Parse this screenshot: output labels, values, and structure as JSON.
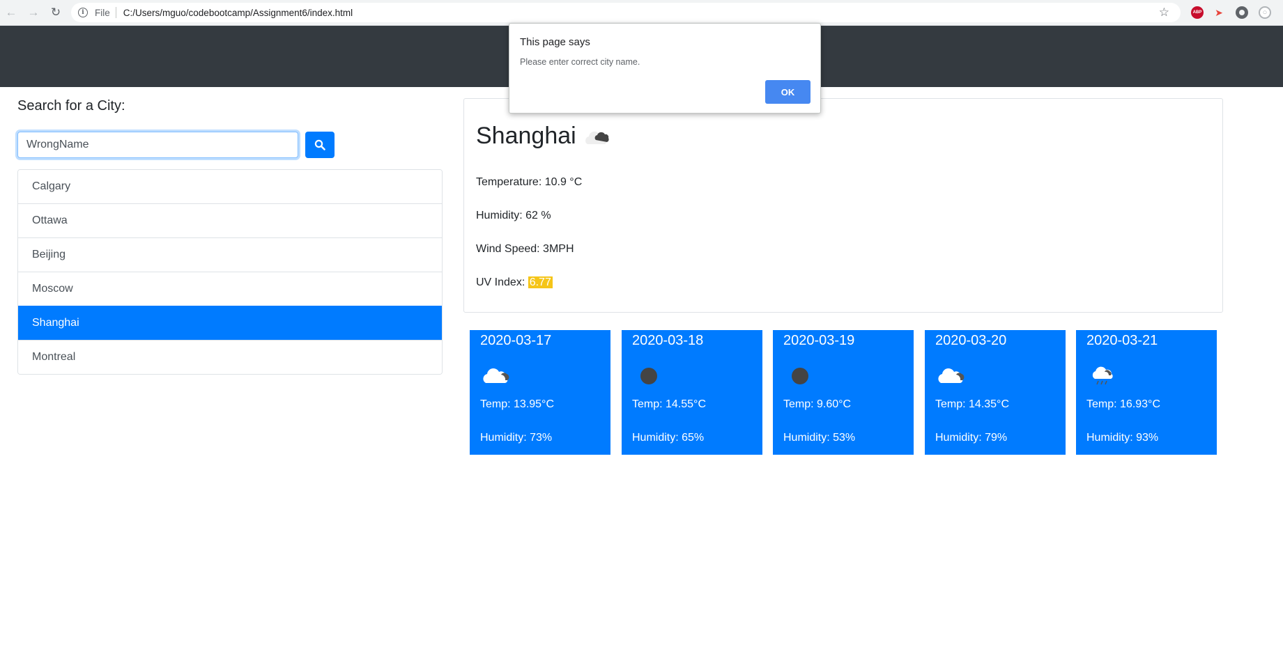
{
  "browser": {
    "file_label": "File",
    "url": "C:/Users/mguo/codebootcamp/Assignment6/index.html",
    "extensions": [
      "ABP"
    ]
  },
  "search": {
    "title": "Search for a City:",
    "value": "WrongName"
  },
  "cities": [
    {
      "name": "Calgary",
      "active": false
    },
    {
      "name": "Ottawa",
      "active": false
    },
    {
      "name": "Beijing",
      "active": false
    },
    {
      "name": "Moscow",
      "active": false
    },
    {
      "name": "Shanghai",
      "active": true
    },
    {
      "name": "Montreal",
      "active": false
    }
  ],
  "current": {
    "city": "Shanghai",
    "icon": "cloudy-icon",
    "temperature": "Temperature: 10.9 °C",
    "humidity": "Humidity: 62 %",
    "wind": "Wind Speed: 3MPH",
    "uv_label": "UV Index: ",
    "uv_value": "6.77",
    "uv_color": "#f5c518"
  },
  "forecast": [
    {
      "date": "2020-03-17",
      "icon": "cloud-icon",
      "temp": "Temp: 13.95°C",
      "humidity": "Humidity: 73%"
    },
    {
      "date": "2020-03-18",
      "icon": "clear-icon",
      "temp": "Temp: 14.55°C",
      "humidity": "Humidity: 65%"
    },
    {
      "date": "2020-03-19",
      "icon": "clear-icon",
      "temp": "Temp: 9.60°C",
      "humidity": "Humidity: 53%"
    },
    {
      "date": "2020-03-20",
      "icon": "cloud-icon",
      "temp": "Temp: 14.35°C",
      "humidity": "Humidity: 79%"
    },
    {
      "date": "2020-03-21",
      "icon": "rain-icon",
      "temp": "Temp: 16.93°C",
      "humidity": "Humidity: 93%"
    }
  ],
  "alert": {
    "title": "This page says",
    "message": "Please enter correct city name.",
    "ok_label": "OK"
  },
  "colors": {
    "header": "#343a40",
    "primary": "#007bff",
    "dialog_button": "#4688f1"
  }
}
